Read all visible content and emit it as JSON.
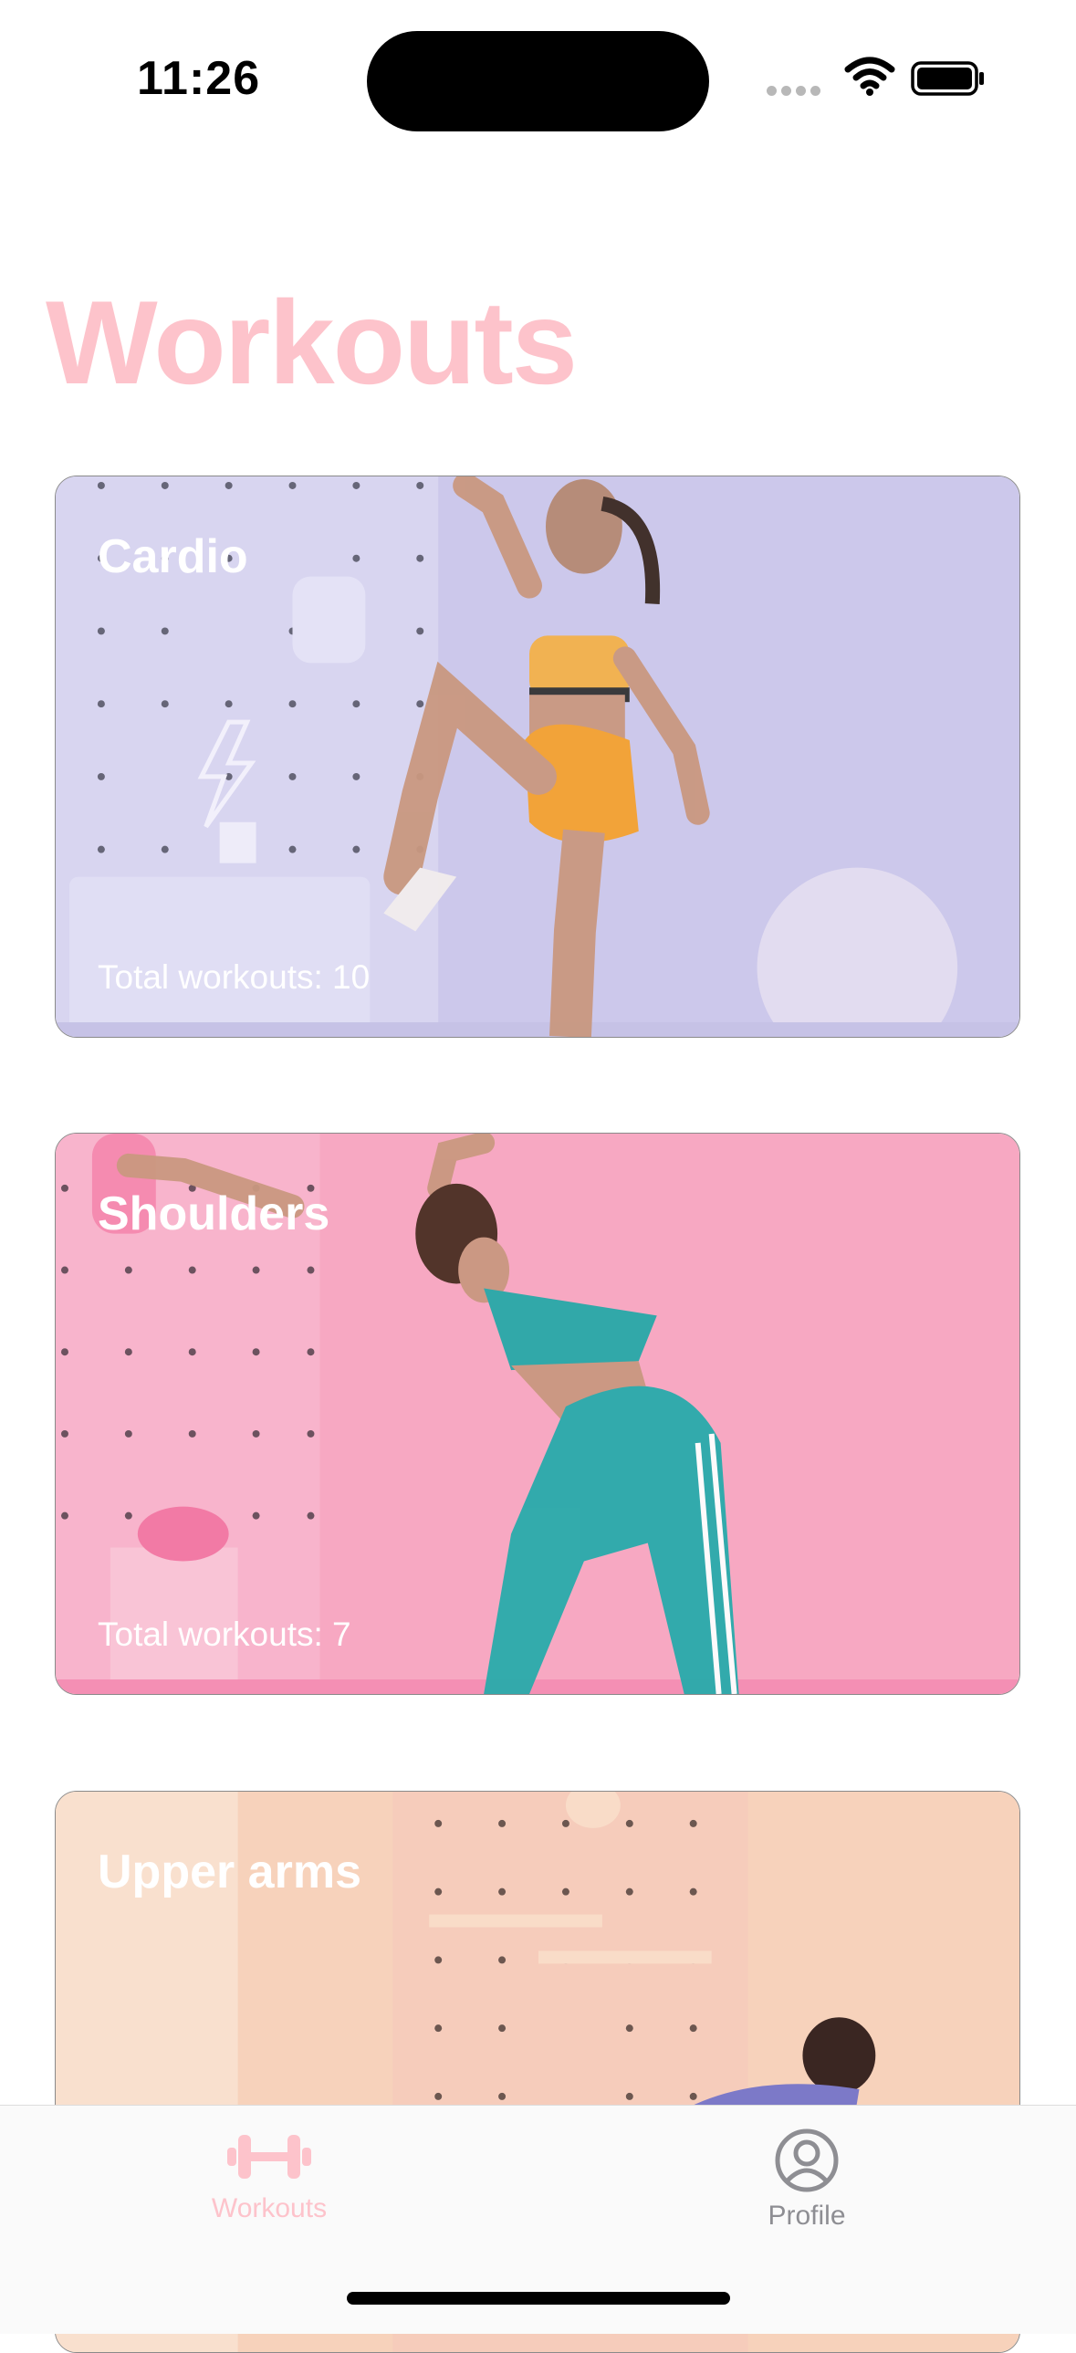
{
  "status_bar": {
    "time": "11:26",
    "icons": [
      "signal-dots-icon",
      "wifi-icon",
      "battery-icon"
    ]
  },
  "page": {
    "title": "Workouts",
    "title_color": "#fdc3cb"
  },
  "categories": [
    {
      "name": "Cardio",
      "count_text": "Total workouts: 10",
      "color": "#ccc8eb"
    },
    {
      "name": "Shoulders",
      "count_text": "Total workouts: 7",
      "color": "#f7a8c2"
    },
    {
      "name": "Upper arms",
      "count_text": "",
      "color": "#f7d2bb"
    }
  ],
  "tab_bar": {
    "tabs": [
      {
        "label": "Workouts",
        "icon": "dumbbell-icon",
        "selected": true
      },
      {
        "label": "Profile",
        "icon": "person-circle-icon",
        "selected": false
      }
    ],
    "active_color": "#fdc3cb",
    "inactive_color": "#8e8e93"
  }
}
